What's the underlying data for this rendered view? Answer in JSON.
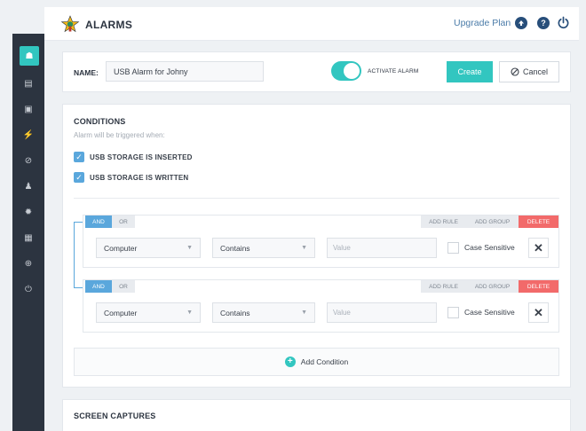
{
  "app": {
    "title": "ALARMS",
    "upgrade_link": "Upgrade Plan",
    "help_glyph": "?",
    "accent": "#32c6c0"
  },
  "sidebar": {
    "items": [
      {
        "name": "sidebar-item-alarms",
        "icon": "alarm-icon",
        "glyph": "☗",
        "active": true
      },
      {
        "name": "sidebar-item-reports",
        "icon": "reports-icon",
        "glyph": "▤"
      },
      {
        "name": "sidebar-item-devices",
        "icon": "device-icon",
        "glyph": "▣"
      },
      {
        "name": "sidebar-item-actions",
        "icon": "bolt-icon",
        "glyph": "⚡"
      },
      {
        "name": "sidebar-item-block",
        "icon": "block-icon",
        "glyph": "⊘"
      },
      {
        "name": "sidebar-item-notifications",
        "icon": "bell-icon",
        "glyph": "♟"
      },
      {
        "name": "sidebar-item-settings",
        "icon": "gear-icon",
        "glyph": "✹"
      },
      {
        "name": "sidebar-item-logs",
        "icon": "document-icon",
        "glyph": "▦"
      },
      {
        "name": "sidebar-item-support",
        "icon": "lifebuoy-icon",
        "glyph": "⊕"
      },
      {
        "name": "sidebar-item-logout",
        "icon": "power-icon",
        "glyph": "⏻"
      }
    ]
  },
  "form": {
    "name_label": "NAME:",
    "name_value": "USB Alarm for Johny",
    "activate_label": "ACTIVATE ALARM",
    "activate_on": true,
    "create_label": "Create",
    "cancel_label": "Cancel"
  },
  "conditions": {
    "title": "CONDITIONS",
    "subtitle": "Alarm will be triggered when:",
    "triggers": [
      {
        "label": "USB STORAGE IS INSERTED",
        "checked": true
      },
      {
        "label": "USB STORAGE IS WRITTEN",
        "checked": true
      }
    ],
    "groups": [
      {
        "and_label": "AND",
        "or_label": "OR",
        "add_rule_label": "ADD RULE",
        "add_group_label": "ADD GROUP",
        "delete_label": "DELETE",
        "rule": {
          "field": "Computer",
          "operator": "Contains",
          "value_placeholder": "Value",
          "case_sensitive_label": "Case Sensitive",
          "case_sensitive": false
        }
      },
      {
        "and_label": "AND",
        "or_label": "OR",
        "add_rule_label": "ADD RULE",
        "add_group_label": "ADD GROUP",
        "delete_label": "DELETE",
        "rule": {
          "field": "Computer",
          "operator": "Contains",
          "value_placeholder": "Value",
          "case_sensitive_label": "Case Sensitive",
          "case_sensitive": false
        }
      }
    ],
    "add_condition_label": "Add Condition"
  },
  "screen_captures": {
    "title": "SCREEN CAPTURES"
  }
}
